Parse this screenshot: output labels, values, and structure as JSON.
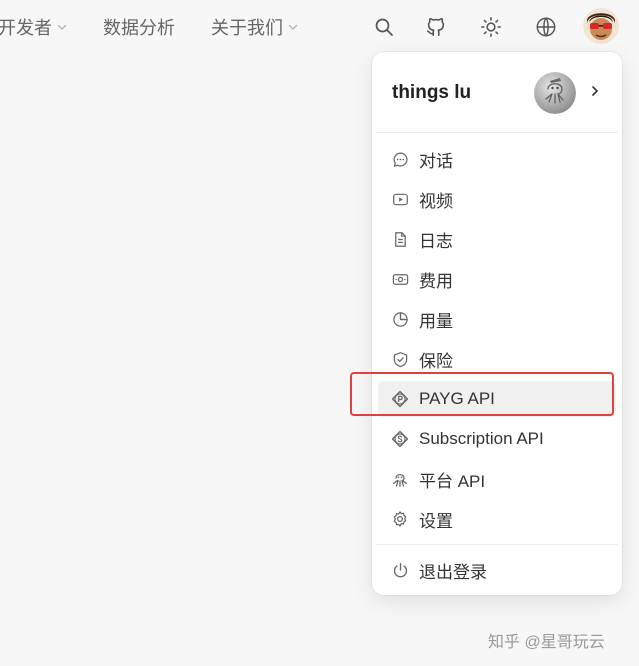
{
  "nav": {
    "developers": "开发者",
    "data_analysis": "数据分析",
    "about": "关于我们"
  },
  "toolbar": {
    "icons": [
      "search-icon",
      "github-icon",
      "sun-icon",
      "globe-icon",
      "avatar"
    ]
  },
  "menu": {
    "user_name": "things lu",
    "items": [
      {
        "label": "对话",
        "icon": "chat-icon"
      },
      {
        "label": "视频",
        "icon": "video-icon"
      },
      {
        "label": "日志",
        "icon": "document-icon"
      },
      {
        "label": "费用",
        "icon": "money-icon"
      },
      {
        "label": "用量",
        "icon": "pie-chart-icon"
      },
      {
        "label": "保险",
        "icon": "shield-icon"
      },
      {
        "label": "PAYG API",
        "icon": "p-coin-icon"
      },
      {
        "label": "Subscription API",
        "icon": "s-coin-icon"
      },
      {
        "label": "平台 API",
        "icon": "octopus-icon"
      },
      {
        "label": "设置",
        "icon": "gear-icon"
      }
    ],
    "logout": "退出登录",
    "active_item": "PAYG API",
    "highlight_color": "#e0403e"
  },
  "watermark": "知乎 @星哥玩云"
}
